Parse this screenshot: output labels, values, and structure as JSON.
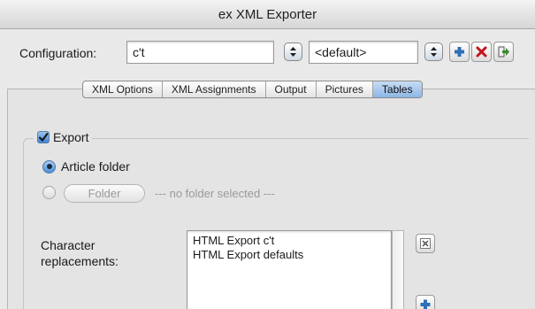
{
  "window": {
    "title": "ex XML Exporter"
  },
  "config": {
    "label": "Configuration:",
    "value": "c't",
    "default_value": "<default>"
  },
  "tabs": [
    {
      "label": "XML Options"
    },
    {
      "label": "XML Assignments"
    },
    {
      "label": "Output"
    },
    {
      "label": "Pictures"
    },
    {
      "label": "Tables",
      "active": true
    }
  ],
  "export": {
    "label": "Export",
    "checked": true,
    "radio_article": "Article folder",
    "folder_button": "Folder",
    "no_folder_text": "--- no folder selected ---"
  },
  "replacements": {
    "label_line1": "Character",
    "label_line2": "replacements:",
    "items": [
      "HTML Export c't",
      "HTML Export defaults"
    ]
  },
  "colors": {
    "add_icon": "#2f6fb8",
    "delete_icon": "#c0161b",
    "export_icon": "#3a8a2c"
  },
  "icons": [
    "stepper-icon",
    "add-icon",
    "delete-icon",
    "export-config-icon",
    "checkmark-icon",
    "edit-replacement-icon"
  ]
}
